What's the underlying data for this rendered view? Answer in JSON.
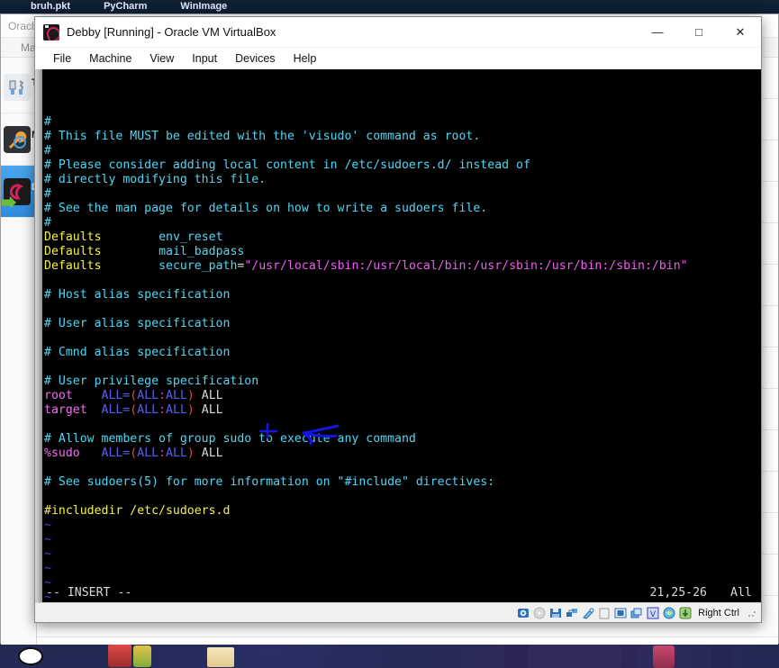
{
  "taskbar": {
    "items": [
      "bruh.pkt",
      "PyCharm",
      "WinImage"
    ]
  },
  "vbox_manager": {
    "title": "Oracle ",
    "menu": "Mac",
    "entries": [
      {
        "label": "To",
        "icon": "tools-icon",
        "selected": false
      },
      {
        "label": "M",
        "icon": "wrench-icon",
        "selected": false
      },
      {
        "label": "De",
        "icon": "debian-swirl-icon",
        "selected": true
      }
    ]
  },
  "vm_window": {
    "title": "Debby [Running] - Oracle VM VirtualBox",
    "icon": "debian-swirl-icon",
    "window_buttons": [
      {
        "name": "minimize-button",
        "glyph": "—"
      },
      {
        "name": "maximize-button",
        "glyph": "□"
      },
      {
        "name": "close-button",
        "glyph": "✕"
      }
    ],
    "menu": [
      "File",
      "Machine",
      "View",
      "Input",
      "Devices",
      "Help"
    ]
  },
  "terminal": {
    "lines": [
      [
        {
          "t": "#",
          "c": "c-comment"
        }
      ],
      [
        {
          "t": "# This file MUST be edited with the 'visudo' command as root.",
          "c": "c-comment"
        }
      ],
      [
        {
          "t": "#",
          "c": "c-comment"
        }
      ],
      [
        {
          "t": "# Please consider adding local content in /etc/sudoers.d/ instead of",
          "c": "c-comment"
        }
      ],
      [
        {
          "t": "# directly modifying this file.",
          "c": "c-comment"
        }
      ],
      [
        {
          "t": "#",
          "c": "c-comment"
        }
      ],
      [
        {
          "t": "# See the man page for details on how to write a sudoers file.",
          "c": "c-comment"
        }
      ],
      [
        {
          "t": "#",
          "c": "c-comment"
        }
      ],
      [
        {
          "t": "Defaults",
          "c": "c-keyword"
        },
        {
          "t": "        ",
          "c": "c-plain"
        },
        {
          "t": "env_reset",
          "c": "c-option"
        }
      ],
      [
        {
          "t": "Defaults",
          "c": "c-keyword"
        },
        {
          "t": "        ",
          "c": "c-plain"
        },
        {
          "t": "mail_badpass",
          "c": "c-option"
        }
      ],
      [
        {
          "t": "Defaults",
          "c": "c-keyword"
        },
        {
          "t": "        ",
          "c": "c-plain"
        },
        {
          "t": "secure_path",
          "c": "c-option"
        },
        {
          "t": "=",
          "c": "c-plain"
        },
        {
          "t": "\"/usr/local/sbin:/usr/local/bin:/usr/sbin:/usr/bin:/sbin:/bin\"",
          "c": "c-string"
        }
      ],
      [],
      [
        {
          "t": "# Host alias specification",
          "c": "c-comment"
        }
      ],
      [],
      [
        {
          "t": "# User alias specification",
          "c": "c-comment"
        }
      ],
      [],
      [
        {
          "t": "# Cmnd alias specification",
          "c": "c-comment"
        }
      ],
      [],
      [
        {
          "t": "# User privilege specification",
          "c": "c-comment"
        }
      ],
      [
        {
          "t": "root",
          "c": "c-user"
        },
        {
          "t": "    ",
          "c": "c-plain"
        },
        {
          "t": "ALL=",
          "c": "c-all"
        },
        {
          "t": "(",
          "c": "c-paren"
        },
        {
          "t": "ALL",
          "c": "c-all"
        },
        {
          "t": ":",
          "c": "c-paren"
        },
        {
          "t": "ALL",
          "c": "c-all"
        },
        {
          "t": ")",
          "c": "c-paren"
        },
        {
          "t": " ALL",
          "c": "c-plain"
        }
      ],
      [
        {
          "t": "target",
          "c": "c-user"
        },
        {
          "t": "  ",
          "c": "c-plain"
        },
        {
          "t": "ALL=",
          "c": "c-all"
        },
        {
          "t": "(",
          "c": "c-paren"
        },
        {
          "t": "ALL",
          "c": "c-all"
        },
        {
          "t": ":",
          "c": "c-paren"
        },
        {
          "t": "ALL",
          "c": "c-all"
        },
        {
          "t": ")",
          "c": "c-paren"
        },
        {
          "t": " ALL",
          "c": "c-plain"
        }
      ],
      [],
      [
        {
          "t": "# Allow members of group sudo to execute any command",
          "c": "c-comment"
        }
      ],
      [
        {
          "t": "%sudo",
          "c": "c-user"
        },
        {
          "t": "   ",
          "c": "c-plain"
        },
        {
          "t": "ALL=",
          "c": "c-all"
        },
        {
          "t": "(",
          "c": "c-paren"
        },
        {
          "t": "ALL",
          "c": "c-all"
        },
        {
          "t": ":",
          "c": "c-paren"
        },
        {
          "t": "ALL",
          "c": "c-all"
        },
        {
          "t": ")",
          "c": "c-paren"
        },
        {
          "t": " ALL",
          "c": "c-plain"
        }
      ],
      [],
      [
        {
          "t": "# See sudoers(5) for more information on \"#include\" directives:",
          "c": "c-comment"
        }
      ],
      [],
      [
        {
          "t": "#includedir /etc/sudoers.d",
          "c": "c-yellow"
        }
      ],
      [
        {
          "t": "~",
          "c": "c-tilde"
        }
      ],
      [
        {
          "t": "~",
          "c": "c-tilde"
        }
      ],
      [
        {
          "t": "~",
          "c": "c-tilde"
        }
      ],
      [
        {
          "t": "~",
          "c": "c-tilde"
        }
      ],
      [
        {
          "t": "~",
          "c": "c-tilde"
        }
      ],
      [
        {
          "t": "~",
          "c": "c-tilde"
        }
      ],
      [
        {
          "t": "~",
          "c": "c-tilde"
        }
      ],
      [
        {
          "t": "~",
          "c": "c-tilde"
        }
      ]
    ],
    "status": {
      "mode": "-- INSERT --",
      "position": "21,25-26",
      "scroll": "All"
    }
  },
  "vm_statusbar": {
    "icons": [
      "hard-disk-icon",
      "optical-disk-icon",
      "floppy-disk-icon",
      "network-icon",
      "usb-icon",
      "shared-folder-icon",
      "display-icon",
      "recording-icon",
      "virtualization-icon",
      "mouse-capture-icon",
      "host-key-icon"
    ],
    "host_key": "Right Ctrl"
  },
  "annotation": {
    "color": "#1414e6",
    "shape": "hand-drawn-left-arrow"
  }
}
